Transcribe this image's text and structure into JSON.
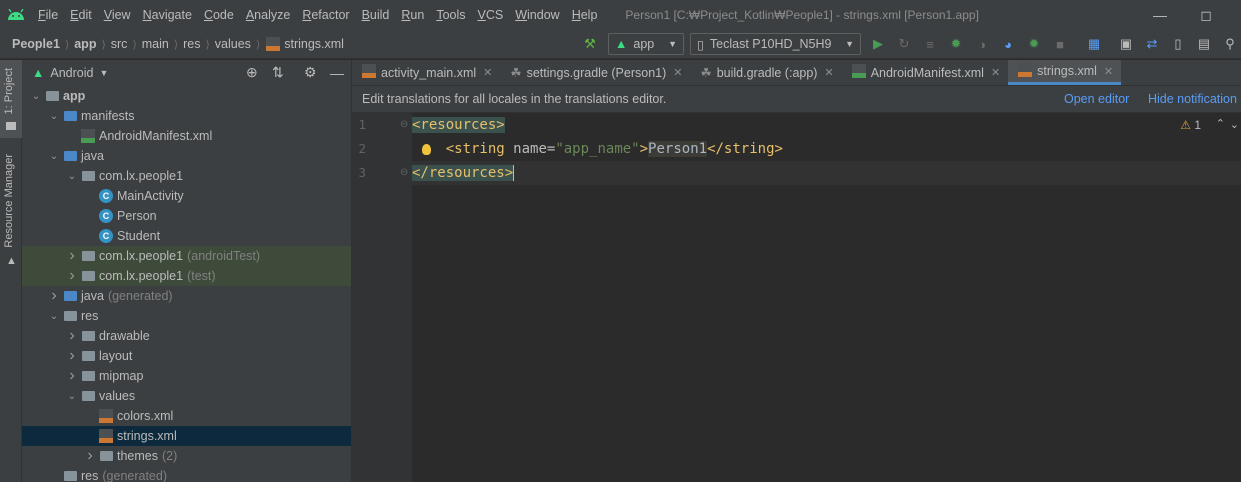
{
  "menubar": {
    "items": [
      {
        "label": "File",
        "u": "F",
        "rest": "ile"
      },
      {
        "label": "Edit",
        "u": "E",
        "rest": "dit"
      },
      {
        "label": "View",
        "u": "V",
        "rest": "iew"
      },
      {
        "label": "Navigate",
        "u": "N",
        "rest": "avigate"
      },
      {
        "label": "Code",
        "u": "C",
        "rest": "ode"
      },
      {
        "label": "Analyze",
        "u": "A",
        "rest": "nalyze"
      },
      {
        "label": "Refactor",
        "u": "R",
        "rest": "efactor"
      },
      {
        "label": "Build",
        "u": "B",
        "rest": "uild"
      },
      {
        "label": "Run",
        "u": "R",
        "rest": "un"
      },
      {
        "label": "Tools",
        "u": "T",
        "rest": "ools"
      },
      {
        "label": "VCS",
        "u": "V",
        "rest": "CS"
      },
      {
        "label": "Window",
        "u": "W",
        "rest": "indow"
      },
      {
        "label": "Help",
        "u": "H",
        "rest": "elp"
      }
    ],
    "window_title": "Person1 [C:₩Project_Kotlin₩People1] - strings.xml [Person1.app]"
  },
  "breadcrumbs": {
    "b0": "People1",
    "b1": "app",
    "b2": "src",
    "b3": "main",
    "b4": "res",
    "b5": "values",
    "b6": "strings.xml"
  },
  "toolbar": {
    "run_config": "app",
    "device": "Teclast P10HD_N5H9"
  },
  "left_strip": {
    "project_tab": "1: Project",
    "resource_tab": "Resource Manager"
  },
  "project_panel": {
    "view_mode": "Android"
  },
  "tree": [
    {
      "label": "app",
      "suffix": ""
    },
    {
      "label": "manifests",
      "suffix": ""
    },
    {
      "label": "AndroidManifest.xml",
      "suffix": ""
    },
    {
      "label": "java",
      "suffix": ""
    },
    {
      "label": "com.lx.people1",
      "suffix": ""
    },
    {
      "label": "MainActivity",
      "suffix": ""
    },
    {
      "label": "Person",
      "suffix": ""
    },
    {
      "label": "Student",
      "suffix": ""
    },
    {
      "label": "com.lx.people1",
      "suffix": "(androidTest)"
    },
    {
      "label": "com.lx.people1",
      "suffix": "(test)"
    },
    {
      "label": "java",
      "suffix": "(generated)"
    },
    {
      "label": "res",
      "suffix": ""
    },
    {
      "label": "drawable",
      "suffix": ""
    },
    {
      "label": "layout",
      "suffix": ""
    },
    {
      "label": "mipmap",
      "suffix": ""
    },
    {
      "label": "values",
      "suffix": ""
    },
    {
      "label": "colors.xml",
      "suffix": ""
    },
    {
      "label": "strings.xml",
      "suffix": ""
    },
    {
      "label": "themes",
      "suffix": "(2)"
    },
    {
      "label": "res",
      "suffix": "(generated)"
    }
  ],
  "tabs": [
    {
      "label": "activity_main.xml"
    },
    {
      "label": "settings.gradle (Person1)"
    },
    {
      "label": "build.gradle (:app)"
    },
    {
      "label": "AndroidManifest.xml"
    },
    {
      "label": "strings.xml"
    }
  ],
  "banner": {
    "text": "Edit translations for all locales in the translations editor.",
    "open_editor": "Open editor",
    "hide": "Hide notification"
  },
  "editor": {
    "line_numbers": [
      "1",
      "2",
      "3"
    ],
    "l1": "<resources>",
    "l2_indent": "    ",
    "l2_open": "<string ",
    "l2_attr": "name=",
    "l2_val": "\"app_name\"",
    "l2_gt": ">",
    "l2_text": "Person1",
    "l2_close": "</string>",
    "l3": "</resources>",
    "warnings": "1"
  }
}
